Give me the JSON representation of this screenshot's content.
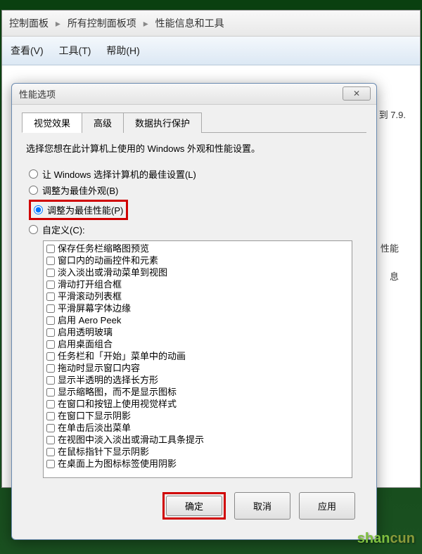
{
  "breadcrumb": {
    "items": [
      "控制面板",
      "所有控制面板项",
      "性能信息和工具"
    ]
  },
  "menubar": {
    "view": "查看(V)",
    "tools": "工具(T)",
    "help": "帮助(H)"
  },
  "content": {
    "version_text": "1.0 到 7.9.",
    "side_label1": "性能",
    "side_label2": "息"
  },
  "dialog": {
    "title": "性能选项",
    "close_symbol": "✕",
    "tabs": {
      "visual": "视觉效果",
      "advanced": "高级",
      "dep": "数据执行保护"
    },
    "instruction": "选择您想在此计算机上使用的 Windows 外观和性能设置。",
    "radios": {
      "let_windows": "让 Windows 选择计算机的最佳设置(L)",
      "best_appearance": "调整为最佳外观(B)",
      "best_performance": "调整为最佳性能(P)",
      "custom": "自定义(C):"
    },
    "checkboxes": [
      "保存任务栏缩略图预览",
      "窗口内的动画控件和元素",
      "淡入淡出或滑动菜单到视图",
      "滑动打开组合框",
      "平滑滚动列表框",
      "平滑屏幕字体边缘",
      "启用 Aero Peek",
      "启用透明玻璃",
      "启用桌面组合",
      "任务栏和「开始」菜单中的动画",
      "拖动时显示窗口内容",
      "显示半透明的选择长方形",
      "显示缩略图，而不是显示图标",
      "在窗口和按钮上使用视觉样式",
      "在窗口下显示阴影",
      "在单击后淡出菜单",
      "在视图中淡入淡出或滑动工具条提示",
      "在鼠标指针下显示阴影",
      "在桌面上为图标标签使用阴影"
    ],
    "buttons": {
      "ok": "确定",
      "cancel": "取消",
      "apply": "应用"
    }
  },
  "watermark": {
    "text1": "shan",
    "text2": "cun"
  }
}
